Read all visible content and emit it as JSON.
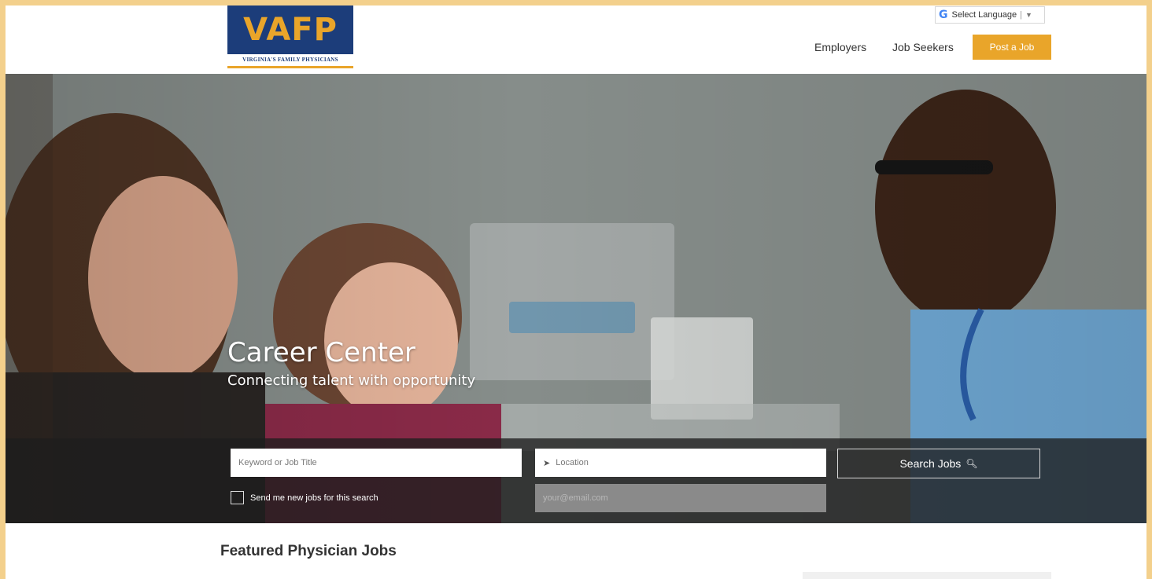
{
  "brand": {
    "logo_text": "VAFP",
    "logo_subtitle": "VIRGINIA'S FAMILY PHYSICIANS",
    "primary_color": "#1c3d7a",
    "accent_color": "#e9a52a"
  },
  "translate": {
    "label": "Select Language",
    "icon": "google-g-icon"
  },
  "nav": {
    "employers": "Employers",
    "job_seekers": "Job Seekers",
    "post_job": "Post a Job"
  },
  "hero": {
    "title": "Career Center",
    "subtitle": "Connecting talent with opportunity"
  },
  "search": {
    "keyword_placeholder": "Keyword or Job Title",
    "location_placeholder": "Location",
    "button_label": "Search Jobs",
    "alert_label": "Send me new jobs for this search",
    "email_placeholder": "your@email.com"
  },
  "featured": {
    "heading": "Featured Physician Jobs"
  }
}
